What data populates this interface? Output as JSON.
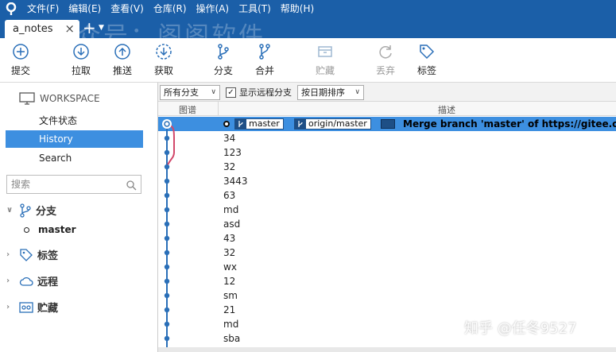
{
  "menubar": {
    "items": [
      "文件(F)",
      "编辑(E)",
      "查看(V)",
      "仓库(R)",
      "操作(A)",
      "工具(T)",
      "帮助(H)"
    ]
  },
  "tabs": {
    "active_label": "a_notes",
    "new_tab_symbol": "+"
  },
  "watermarks": {
    "top": "公众号：阁阁软件",
    "bottom": "知乎 @任冬9527"
  },
  "toolbar": {
    "commit": "提交",
    "pull": "拉取",
    "push": "推送",
    "fetch": "获取",
    "branch": "分支",
    "merge": "合并",
    "stash": "贮藏",
    "discard": "丢弃",
    "tag": "标签"
  },
  "sidebar": {
    "workspace_label": "WORKSPACE",
    "nav": [
      "文件状态",
      "History",
      "Search"
    ],
    "active_nav": "History",
    "search_placeholder": "搜索",
    "branches_label": "分支",
    "current_branch": "master",
    "tags_label": "标签",
    "remotes_label": "远程",
    "stashes_label": "贮藏"
  },
  "filters": {
    "branch_filter": "所有分支",
    "show_remote_label": "显示远程分支",
    "show_remote_checked": true,
    "sort_order": "按日期排序"
  },
  "columns": {
    "graph": "图谱",
    "description": "描述"
  },
  "commits": {
    "head": {
      "local_branch": "master",
      "remote_branch": "origin/master",
      "message": "Merge branch 'master' of https://gitee.com/y"
    },
    "messages": [
      "34",
      "123",
      "32",
      "3443",
      "63",
      "md",
      "asd",
      "43",
      "32",
      "wx",
      "12",
      "sm",
      "21",
      "md",
      "sba"
    ]
  },
  "colors": {
    "accent": "#1b5fa8",
    "selection": "#3d8fe0",
    "graph_main": "#2a6fb8",
    "graph_branch": "#d2486a"
  }
}
